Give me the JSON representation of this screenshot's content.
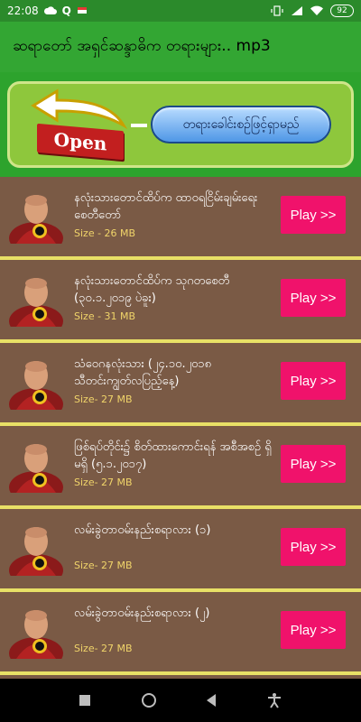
{
  "status_bar": {
    "time": "22:08",
    "left_icons": [
      "cloud-icon",
      "q-icon",
      "flag-icon"
    ],
    "right_icons": [
      "vibrate-icon",
      "signal-icon",
      "wifi-icon",
      "battery-icon"
    ],
    "battery": "92"
  },
  "app_bar": {
    "title": "ဆရာတော် အရှင်ဆန္ဒာဓိက တရားများ.. mp3"
  },
  "banner": {
    "open_label": "Open",
    "pill_label": "တရားခေါင်းစဉ်ဖြင့်ရှာမည်"
  },
  "items": [
    {
      "title": "နလုံးသားတောင်ထိပ်က ထာဝရငြိမ်းချမ်းရေးစေတီတော်",
      "size": "Size - 26 MB",
      "play": "Play >>"
    },
    {
      "title": "နလုံးသားတောင်ထိပ်က သုဂတစေတီ (၃၀.၁.၂၀၁၉ ပဲခူး)",
      "size": "Size - 31 MB",
      "play": "Play >>"
    },
    {
      "title": "သံဝေဂနလုံးသား (၂၄.၁၀.၂၀၁၈ သီတင်းကျွတ်လပြည့်နေ့)",
      "size": "Size- 27 MB",
      "play": "Play >>"
    },
    {
      "title": "ဖြစ်ရပ်တိုင်း၌ စိတ်ထားကောင်းရန် အစီအစဉ် ရှိမရှိ (၅.၁.၂၀၁၇)",
      "size": "Size- 27 MB",
      "play": "Play >>"
    },
    {
      "title": "လမ်းခွဲတာဝမ်းနည်းစရာလား (၁)",
      "size": "Size- 27 MB",
      "play": "Play >>"
    },
    {
      "title": "လမ်းခွဲတာဝမ်းနည်းစရာလား (၂)",
      "size": "Size- 27 MB",
      "play": "Play >>"
    }
  ],
  "nav_bar": {
    "icons": [
      "recents-icon",
      "home-icon",
      "back-icon",
      "accessibility-icon"
    ]
  },
  "colors": {
    "status_bar": "#2b8a2b",
    "app_bar": "#33a633",
    "list_bg": "#7a5a45",
    "divider": "#e8e066",
    "play_button": "#f0126b",
    "size_text": "#f0d46a"
  }
}
